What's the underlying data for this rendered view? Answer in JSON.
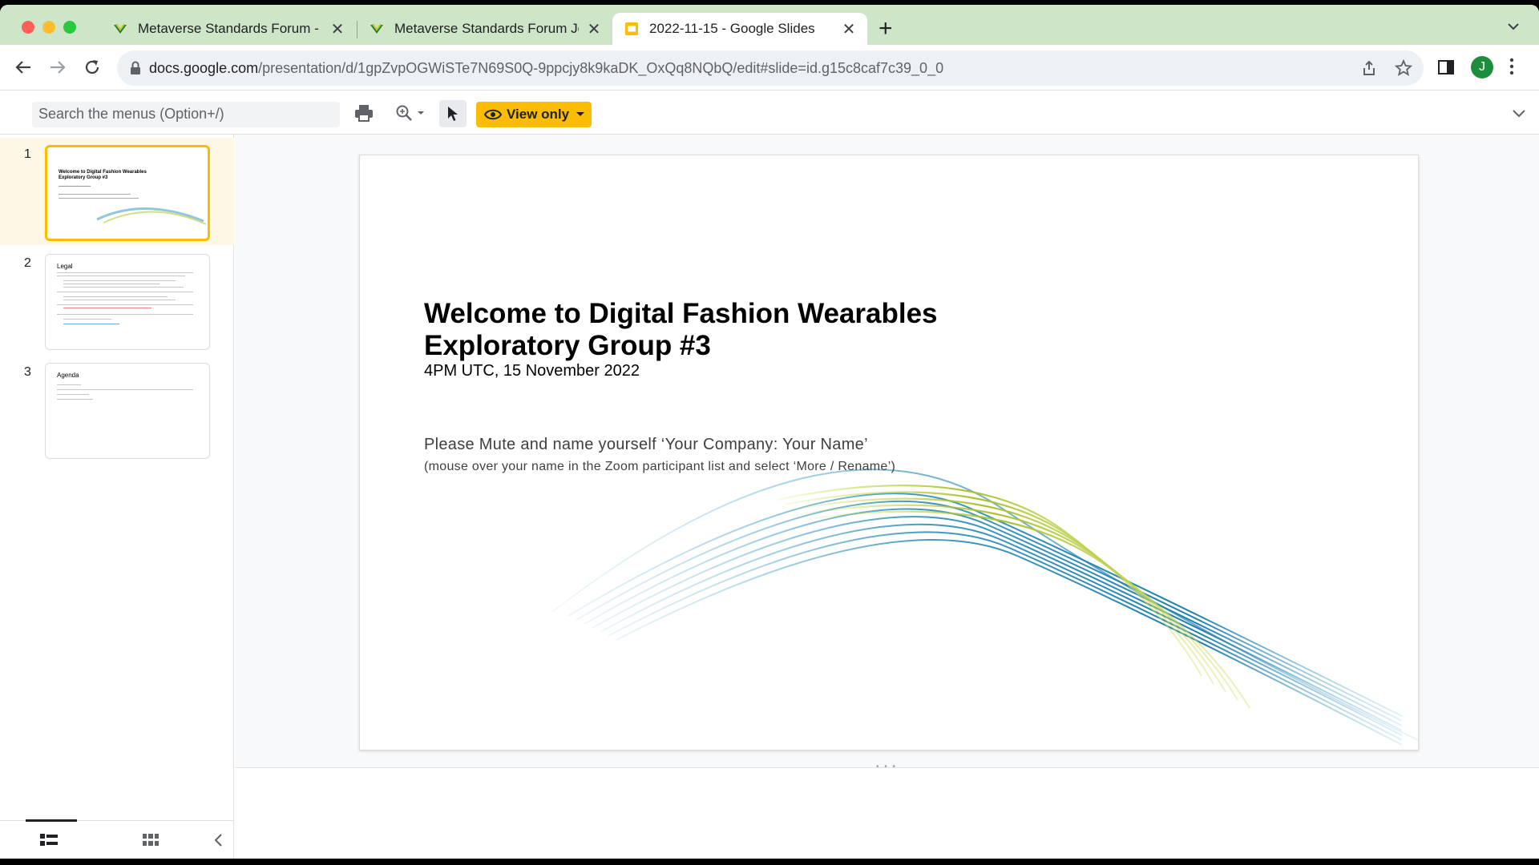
{
  "browser": {
    "tabs": [
      {
        "title": "Metaverse Standards Forum - I",
        "active": false
      },
      {
        "title": "Metaverse Standards Forum Jo",
        "active": false
      },
      {
        "title": "2022-11-15 - Google Slides",
        "active": true
      }
    ],
    "url_host": "docs.google.com",
    "url_path": "/presentation/d/1gpZvpOGWiSTe7N69S0Q-9ppcjy8k9kaDK_OxQq8NQbQ/edit#slide=id.g15c8caf7c39_0_0",
    "profile_initial": "J",
    "colors": {
      "tabstrip": "#cfe5c8",
      "accent_yellow": "#fbbc04",
      "profile": "#1e8e3e"
    }
  },
  "menubar": {
    "search_placeholder": "Search the menus (Option+/)",
    "view_only_label": "View only"
  },
  "filmstrip": {
    "slides": [
      {
        "number": "1",
        "title": "Welcome to Digital Fashion Wearables Exploratory Group #3"
      },
      {
        "number": "2",
        "title": "Legal"
      },
      {
        "number": "3",
        "title": "Agenda"
      }
    ]
  },
  "slide": {
    "title_line1": "Welcome to Digital Fashion Wearables",
    "title_line2": "Exploratory Group #3",
    "subtitle": "4PM UTC, 15 November 2022",
    "mute_text": "Please Mute and name yourself ‘Your Company: Your Name’",
    "hint_text": "(mouse over your name in the Zoom participant list and select ‘More / Rename’)"
  }
}
